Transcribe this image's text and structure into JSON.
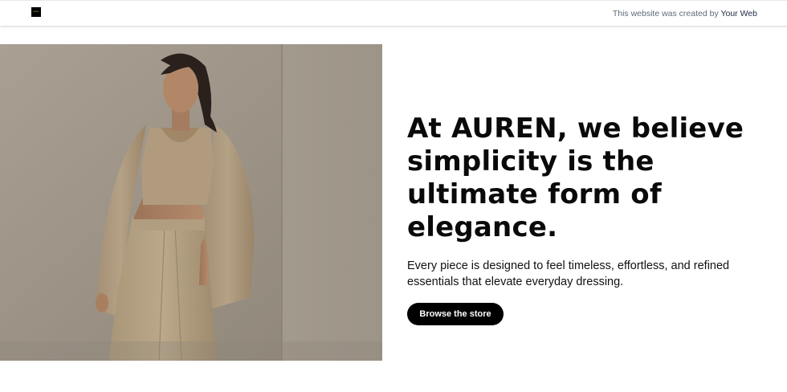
{
  "header": {
    "logo_text": "AUREN",
    "credit_prefix": "This website was created by",
    "credit_link": "Your Web"
  },
  "hero": {
    "headline": "At AUREN, we believe simplicity is the ultimate form of elegance.",
    "subtext": "Every piece is designed to feel timeless, effortless, and refined essentials that elevate everyday dressing.",
    "cta_label": "Browse the store"
  },
  "colors": {
    "background": "#ffffff",
    "cta_background": "#000000",
    "photo_wall": "#a69c8f",
    "outfit": "#b4a186"
  }
}
